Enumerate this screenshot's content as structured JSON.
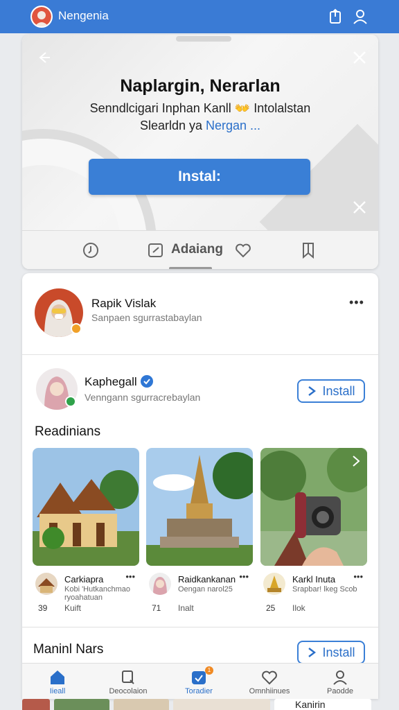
{
  "topbar": {
    "title": "Nengenia",
    "icons": [
      "share-icon",
      "profile-icon"
    ],
    "color": "#3a7bd5"
  },
  "promo": {
    "title": "Naplargin, Neraгlan",
    "line1_part1": "Senndlcigari Inphan Kanll",
    "line1_emoji": "👐",
    "line1_part2": "Intolalstan",
    "line2_part1": "Slearldn ya",
    "line2_link": "Nergan ...",
    "install_label": "Instal:",
    "accent": "#3a7fd6"
  },
  "actions": {
    "label": "Adaiang",
    "icons": [
      "clock-icon",
      "edit-icon",
      "heart-icon",
      "bookmark-icon"
    ]
  },
  "post1": {
    "name": "Rapik Vislak",
    "subtitle": "Sanpaen sgurrastabaylan",
    "more": "•••"
  },
  "post2": {
    "name": "Kaphegall",
    "subtitle": "Venngann sgurracrebaylan",
    "install_label": "Install"
  },
  "section1": {
    "title": "Readinians",
    "tiles": [
      {
        "name": "Carkiapra",
        "sub": "Kobi 'Hutkanchmao ryoahatuan",
        "count": "39",
        "meta": "Kuift",
        "more": "•••"
      },
      {
        "name": "Raidkankanan",
        "sub": "Oengan narol25",
        "count": "71",
        "meta": "Inalt",
        "more": "•••"
      },
      {
        "name": "Karkl Inuta",
        "sub": "Sraрbar! lkeg Scob",
        "count": "25",
        "meta": "Ilok",
        "more": "•••"
      }
    ]
  },
  "section2": {
    "title": "Maninl Nars",
    "install_label": "Install"
  },
  "bottomnav": {
    "items": [
      {
        "label": "Iieall",
        "icon": "home-icon",
        "active": true
      },
      {
        "label": "Deocolaion",
        "icon": "search-icon",
        "active": false
      },
      {
        "label": "Toradier",
        "icon": "upload-icon",
        "active": true,
        "badge": "1"
      },
      {
        "label": "Omnhiinues",
        "icon": "heart-icon",
        "active": false
      },
      {
        "label": "Paodde",
        "icon": "profile-icon",
        "active": false
      }
    ]
  },
  "peek": {
    "label": "Kanirin"
  }
}
